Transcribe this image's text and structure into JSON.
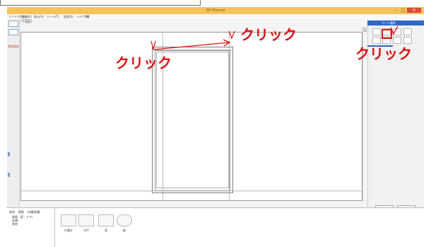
{
  "window": {
    "title": "3D Planner",
    "controls": [
      "–",
      "□",
      "✕"
    ]
  },
  "menu": {
    "items": [
      "ファイル(F)",
      "編集(E)",
      "表示(V)",
      "ツール(T)",
      "設定(S)",
      "ヘルプ(H)",
      "3D"
    ]
  },
  "subtab": "平面図",
  "leftbar": {
    "label": "窓枠設定"
  },
  "right_panel": {
    "header": "パーツ選択",
    "ok_label": "OK",
    "cancel_label": "キャンセル"
  },
  "bottom": {
    "tabs": [
      "部材",
      "壁紙",
      "外構/設備"
    ],
    "tree": [
      "建具（窓・ドア）",
      "外構",
      "窓枠"
    ],
    "palette": [
      {
        "label": "片開き",
        "icon": "door-icon"
      },
      {
        "label": "引戸",
        "icon": "sliding-door-icon"
      },
      {
        "label": "窓",
        "icon": "window-icon"
      },
      {
        "label": "扉",
        "icon": "round-icon"
      }
    ]
  },
  "annotations": {
    "click_left": "クリック",
    "click_top": "クリック",
    "click_right": "クリック",
    "color": "#dd1111"
  }
}
